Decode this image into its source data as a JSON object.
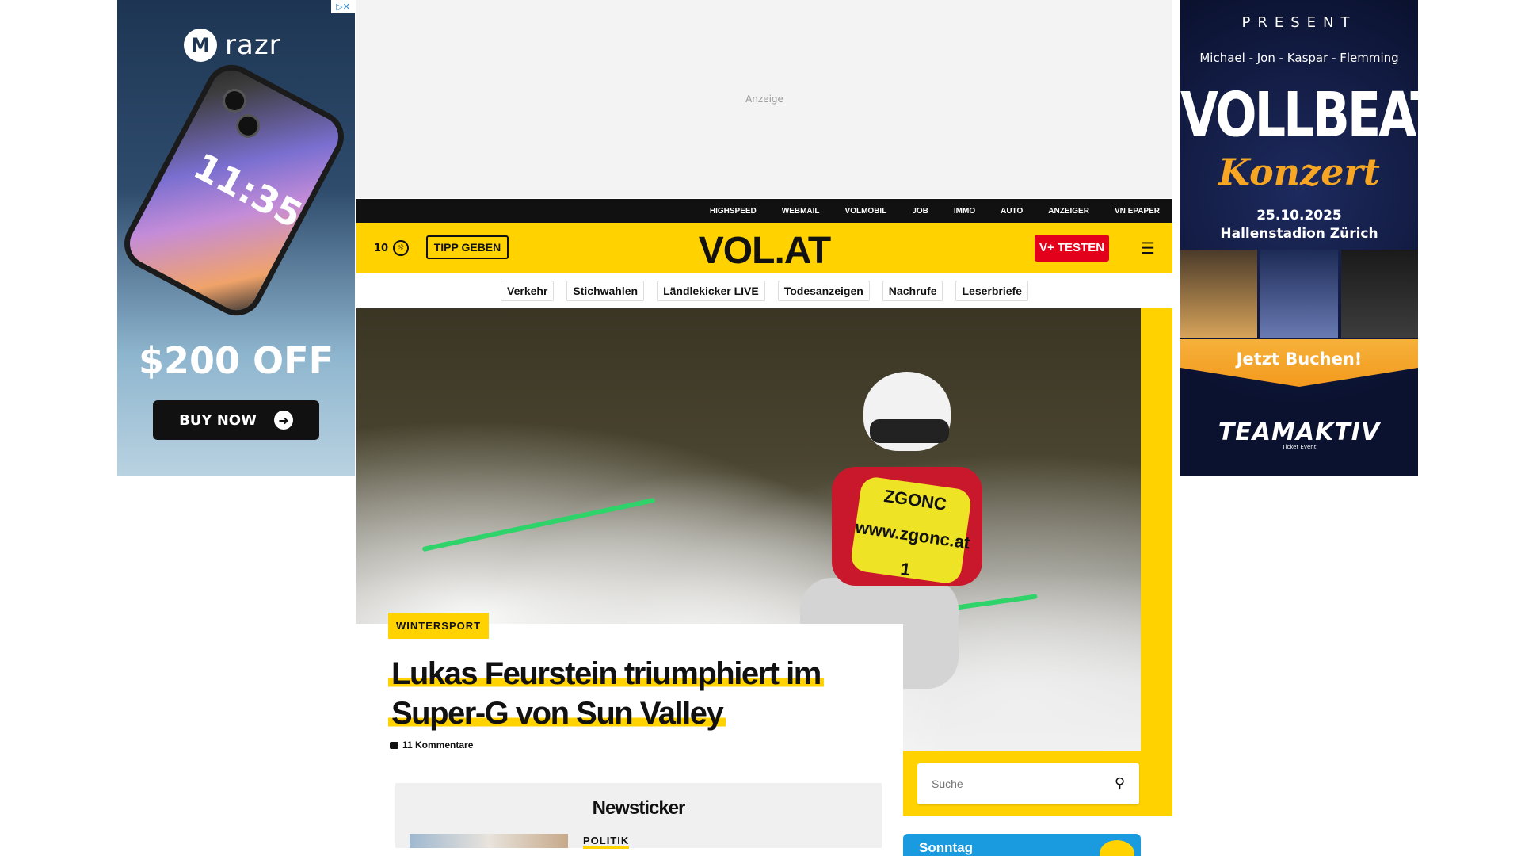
{
  "ads": {
    "left": {
      "brand": "razr",
      "clock": "11:35",
      "offer": "$200 OFF",
      "cta": "BUY NOW"
    },
    "top": {
      "label": "Anzeige"
    },
    "right": {
      "present": "PRESENT",
      "names": "Michael - Jon - Kaspar - Flemming",
      "title": "VOLLBEAT",
      "subtitle": "Konzert",
      "date": "25.10.2025",
      "venue": "Hallenstadion Zürich",
      "cta": "Jetzt Buchen!",
      "sponsor": "TEAMAKTIV",
      "sponsor_sub": "Ticket Event"
    }
  },
  "topbar": {
    "links": [
      "HIGHSPEED",
      "WEBMAIL",
      "VOLMOBIL",
      "JOB",
      "IMMO",
      "AUTO",
      "ANZEIGER",
      "VN EPAPER"
    ]
  },
  "header": {
    "temperature": "10",
    "tipp_label": "TIPP GEBEN",
    "logo": "VOL.AT",
    "vplus_label": "V+ TESTEN"
  },
  "subnav": {
    "items": [
      "Verkehr",
      "Stichwahlen",
      "Ländlekicker LIVE",
      "Todesanzeigen",
      "Nachrufe",
      "Leserbriefe"
    ]
  },
  "hero": {
    "category": "WINTERSPORT",
    "headline_line1": "Lukas Feurstein triumphiert im",
    "headline_line2": "Super-G von Sun Valley",
    "comments": "11 Kommentare",
    "bib_text": "ZGONC www.zgonc.at 1"
  },
  "newsticker": {
    "title": "Newsticker",
    "first_category": "POLITIK"
  },
  "search": {
    "placeholder": "Suche"
  },
  "weather": {
    "day": "Sonntag"
  },
  "colors": {
    "brand_yellow": "#ffd200",
    "vplus_red": "#e3001b",
    "weather_blue": "#1a9be0"
  }
}
